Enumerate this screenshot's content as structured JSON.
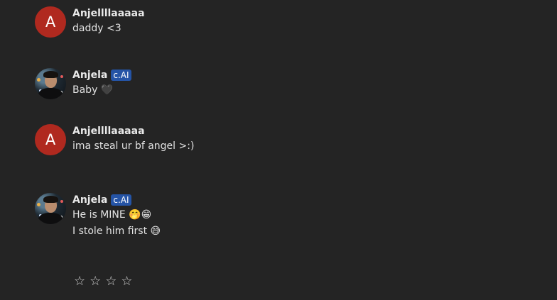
{
  "messages": [
    {
      "name": "Anjellllaaaaa",
      "avatar_letter": "A",
      "lines": [
        "daddy <3"
      ]
    },
    {
      "name": "Anjela",
      "badge": "c.AI",
      "lines": [
        "Baby 🖤"
      ]
    },
    {
      "name": "Anjellllaaaaa",
      "avatar_letter": "A",
      "lines": [
        "ima steal ur bf angel >:)"
      ]
    },
    {
      "name": "Anjela",
      "badge": "c.AI",
      "lines": [
        "He is MINE 🤭😁",
        "I stole him first 😅"
      ]
    }
  ],
  "rating": {
    "stars": [
      "☆",
      "☆",
      "☆",
      "☆"
    ]
  },
  "colors": {
    "background": "#242424",
    "letter_avatar": "#b0291f",
    "badge": "#2554a6"
  }
}
